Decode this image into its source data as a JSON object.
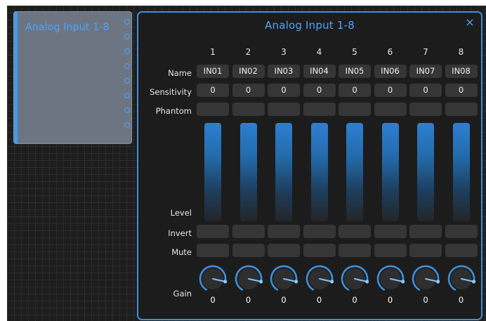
{
  "node": {
    "title": "Analog Input 1-8"
  },
  "dialog": {
    "title": "Analog Input 1-8",
    "close_glyph": "×",
    "row_labels": {
      "name": "Name",
      "sensitivity": "Sensitivity",
      "phantom": "Phantom",
      "level": "Level",
      "invert": "Invert",
      "mute": "Mute",
      "gain": "Gain"
    },
    "channels": [
      {
        "number": "1",
        "name": "IN01",
        "sensitivity": "0",
        "gain": "0",
        "phantom": false,
        "invert": false,
        "mute": false
      },
      {
        "number": "2",
        "name": "IN02",
        "sensitivity": "0",
        "gain": "0",
        "phantom": false,
        "invert": false,
        "mute": false
      },
      {
        "number": "3",
        "name": "IN03",
        "sensitivity": "0",
        "gain": "0",
        "phantom": false,
        "invert": false,
        "mute": false
      },
      {
        "number": "4",
        "name": "IN04",
        "sensitivity": "0",
        "gain": "0",
        "phantom": false,
        "invert": false,
        "mute": false
      },
      {
        "number": "5",
        "name": "IN05",
        "sensitivity": "0",
        "gain": "0",
        "phantom": false,
        "invert": false,
        "mute": false
      },
      {
        "number": "6",
        "name": "IN06",
        "sensitivity": "0",
        "gain": "0",
        "phantom": false,
        "invert": false,
        "mute": false
      },
      {
        "number": "7",
        "name": "IN07",
        "sensitivity": "0",
        "gain": "0",
        "phantom": false,
        "invert": false,
        "mute": false
      },
      {
        "number": "8",
        "name": "IN08",
        "sensitivity": "0",
        "gain": "0",
        "phantom": false,
        "invert": false,
        "mute": false
      }
    ]
  },
  "colors": {
    "accent": "#3d8fda",
    "title_blue": "#4aa6ff",
    "cell_bg": "#363636",
    "background": "#1c1c1c"
  },
  "icons": {
    "close": "close-icon",
    "gain_knob": "knob-icon",
    "port": "port-icon"
  }
}
